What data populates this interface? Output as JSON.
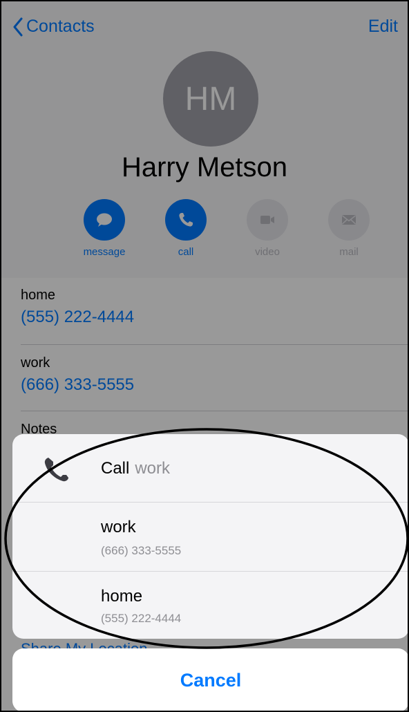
{
  "nav": {
    "back_label": "Contacts",
    "edit_label": "Edit"
  },
  "contact": {
    "initials": "HM",
    "name": "Harry Metson"
  },
  "actions": [
    {
      "label": "message",
      "icon": "message-bubble-icon",
      "enabled": true
    },
    {
      "label": "call",
      "icon": "phone-icon",
      "enabled": true
    },
    {
      "label": "video",
      "icon": "video-camera-icon",
      "enabled": false
    },
    {
      "label": "mail",
      "icon": "envelope-icon",
      "enabled": false
    }
  ],
  "fields": [
    {
      "label": "home",
      "value": "(555) 222-4444"
    },
    {
      "label": "work",
      "value": "(666) 333-5555"
    }
  ],
  "notes_label": "Notes",
  "share_label": "Share My Location",
  "sheet": {
    "title": "Call",
    "title_sub": "work",
    "options": [
      {
        "label": "work",
        "number": "(666) 333-5555"
      },
      {
        "label": "home",
        "number": "(555) 222-4444"
      }
    ]
  },
  "cancel_label": "Cancel",
  "colors": {
    "accent": "#007aff",
    "dim": "#000000"
  }
}
